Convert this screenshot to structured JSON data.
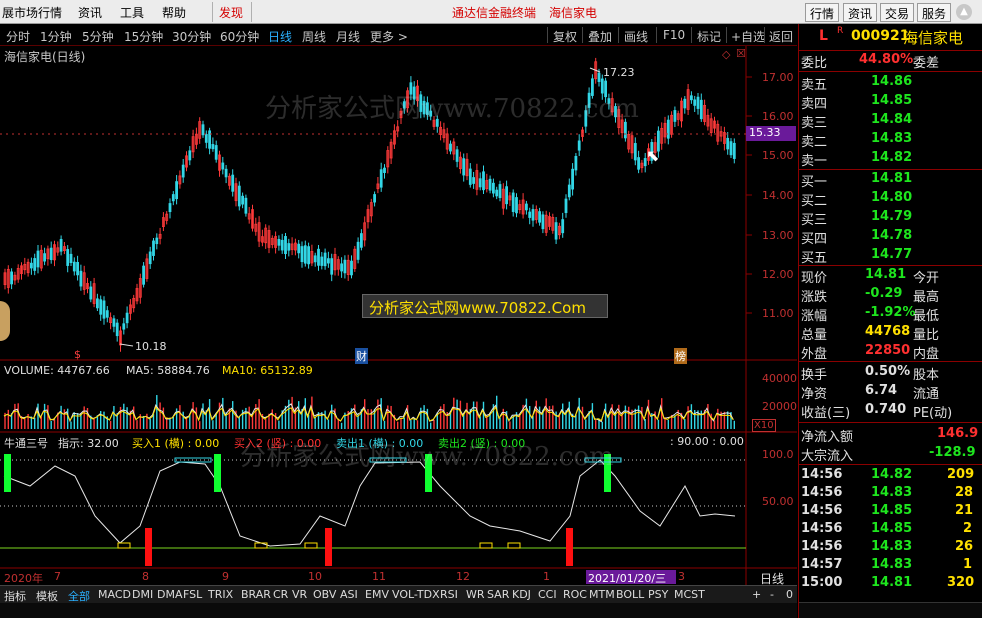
{
  "menubar": {
    "items": [
      "展市场行情",
      "资讯",
      "工具",
      "帮助"
    ],
    "alert": "发现",
    "center": [
      "通达信金融终端",
      "海信家电"
    ],
    "right_buttons": [
      "行情",
      "资讯",
      "交易",
      "服务"
    ]
  },
  "toolbar": {
    "periods": [
      "分时",
      "1分钟",
      "5分钟",
      "15分钟",
      "30分钟",
      "60分钟",
      "日线",
      "周线",
      "月线",
      "更多 >"
    ],
    "active": "日线",
    "right_buttons": [
      "复权",
      "叠加",
      "画线",
      "F10",
      "标记",
      "+自选",
      "返回"
    ]
  },
  "chart_title": "海信家电(日线)",
  "watermark_text": "分析家公式网www.70822.com",
  "watermark_box": "分析家公式网www.70822.Com",
  "price_chart": {
    "max_label": "17.23",
    "min_label": "10.18",
    "current_price_tag": "15.33",
    "axis_labels": [
      "17.00",
      "16.00",
      "15.00",
      "14.00",
      "13.00",
      "12.00",
      "11.00"
    ],
    "markers": [
      "$",
      "财",
      "榜"
    ]
  },
  "volume": {
    "label": "VOLUME: 44767.66",
    "ma5": "MA5: 58884.76",
    "ma10": "MA10: 65132.89",
    "axis_labels": [
      "40000",
      "20000"
    ],
    "unit": "X10"
  },
  "indicator": {
    "name": "牛通三号",
    "hint": "指示: 32.00",
    "buy1": "买入1 (横) : 0.00",
    "buy2": "买入2 (竖) : 0.00",
    "sell1": "卖出1 (横) : 0.00",
    "sell2": "卖出2 (竖) : 0.00",
    "extra": ": 90.00 : 0.00",
    "axis_labels": [
      "100.0",
      "50.00"
    ]
  },
  "time_axis": [
    "2020年",
    "7",
    "8",
    "9",
    "10",
    "11",
    "12",
    "1",
    "2021/01/20/三",
    "3"
  ],
  "time_axis_right": "日线",
  "bottom_tabs": [
    "指标",
    "模板",
    "全部",
    "MACD",
    "DMI",
    "DMA",
    "FSL",
    "TRIX",
    "BRAR",
    "CR",
    "VR",
    "OBV",
    "ASI",
    "EMV",
    "VOL-TDX",
    "RSI",
    "WR",
    "SAR",
    "KDJ",
    "CCI",
    "ROC",
    "MTM",
    "BOLL",
    "PSY",
    "MCST"
  ],
  "bottom_controls": [
    "+",
    "-",
    "0"
  ],
  "quote": {
    "code": "000921",
    "name": "海信家电",
    "L": "L",
    "R": "R",
    "weibi_label": "委比",
    "weibi_value": "44.80%",
    "weicha_label": "委差",
    "sells": [
      {
        "label": "卖五",
        "price": "14.86"
      },
      {
        "label": "卖四",
        "price": "14.85"
      },
      {
        "label": "卖三",
        "price": "14.84"
      },
      {
        "label": "卖二",
        "price": "14.83"
      },
      {
        "label": "卖一",
        "price": "14.82"
      }
    ],
    "buys": [
      {
        "label": "买一",
        "price": "14.81"
      },
      {
        "label": "买二",
        "price": "14.80"
      },
      {
        "label": "买三",
        "price": "14.79"
      },
      {
        "label": "买四",
        "price": "14.78"
      },
      {
        "label": "买五",
        "price": "14.77"
      }
    ],
    "stats": [
      {
        "l": "现价",
        "v": "14.81",
        "r": "今开",
        "color": "#1ee61e"
      },
      {
        "l": "涨跌",
        "v": "-0.29",
        "r": "最高",
        "color": "#1ee61e"
      },
      {
        "l": "涨幅",
        "v": "-1.92%",
        "r": "最低",
        "color": "#1ee61e"
      },
      {
        "l": "总量",
        "v": "44768",
        "r": "量比",
        "color": "#ffe000"
      },
      {
        "l": "外盘",
        "v": "22850",
        "r": "内盘",
        "color": "#ff3030"
      }
    ],
    "stats2": [
      {
        "l": "换手",
        "v": "0.50%",
        "r": "股本",
        "color": "#e0e0e0"
      },
      {
        "l": "净资",
        "v": "6.74",
        "r": "流通",
        "color": "#e0e0e0"
      },
      {
        "l": "收益(三)",
        "v": "0.740",
        "r": "PE(动)",
        "color": "#e0e0e0"
      }
    ],
    "netflow_label": "净流入额",
    "netflow_value": "146.9",
    "bigflow_label": "大宗流入",
    "bigflow_value": "-128.9",
    "ticks": [
      {
        "time": "14:56",
        "price": "14.82",
        "vol": "209"
      },
      {
        "time": "14:56",
        "price": "14.83",
        "vol": "28"
      },
      {
        "time": "14:56",
        "price": "14.85",
        "vol": "21"
      },
      {
        "time": "14:56",
        "price": "14.85",
        "vol": "2"
      },
      {
        "time": "14:56",
        "price": "14.83",
        "vol": "26"
      },
      {
        "time": "14:57",
        "price": "14.83",
        "vol": "1"
      },
      {
        "time": "15:00",
        "price": "14.81",
        "vol": "320"
      }
    ]
  },
  "colors": {
    "up": "#ff3a3a",
    "down": "#32d6e6",
    "ma5": "#e8e8e8",
    "ma10": "#ffe000",
    "buy": "#ff1010",
    "sell": "#10ff30"
  }
}
